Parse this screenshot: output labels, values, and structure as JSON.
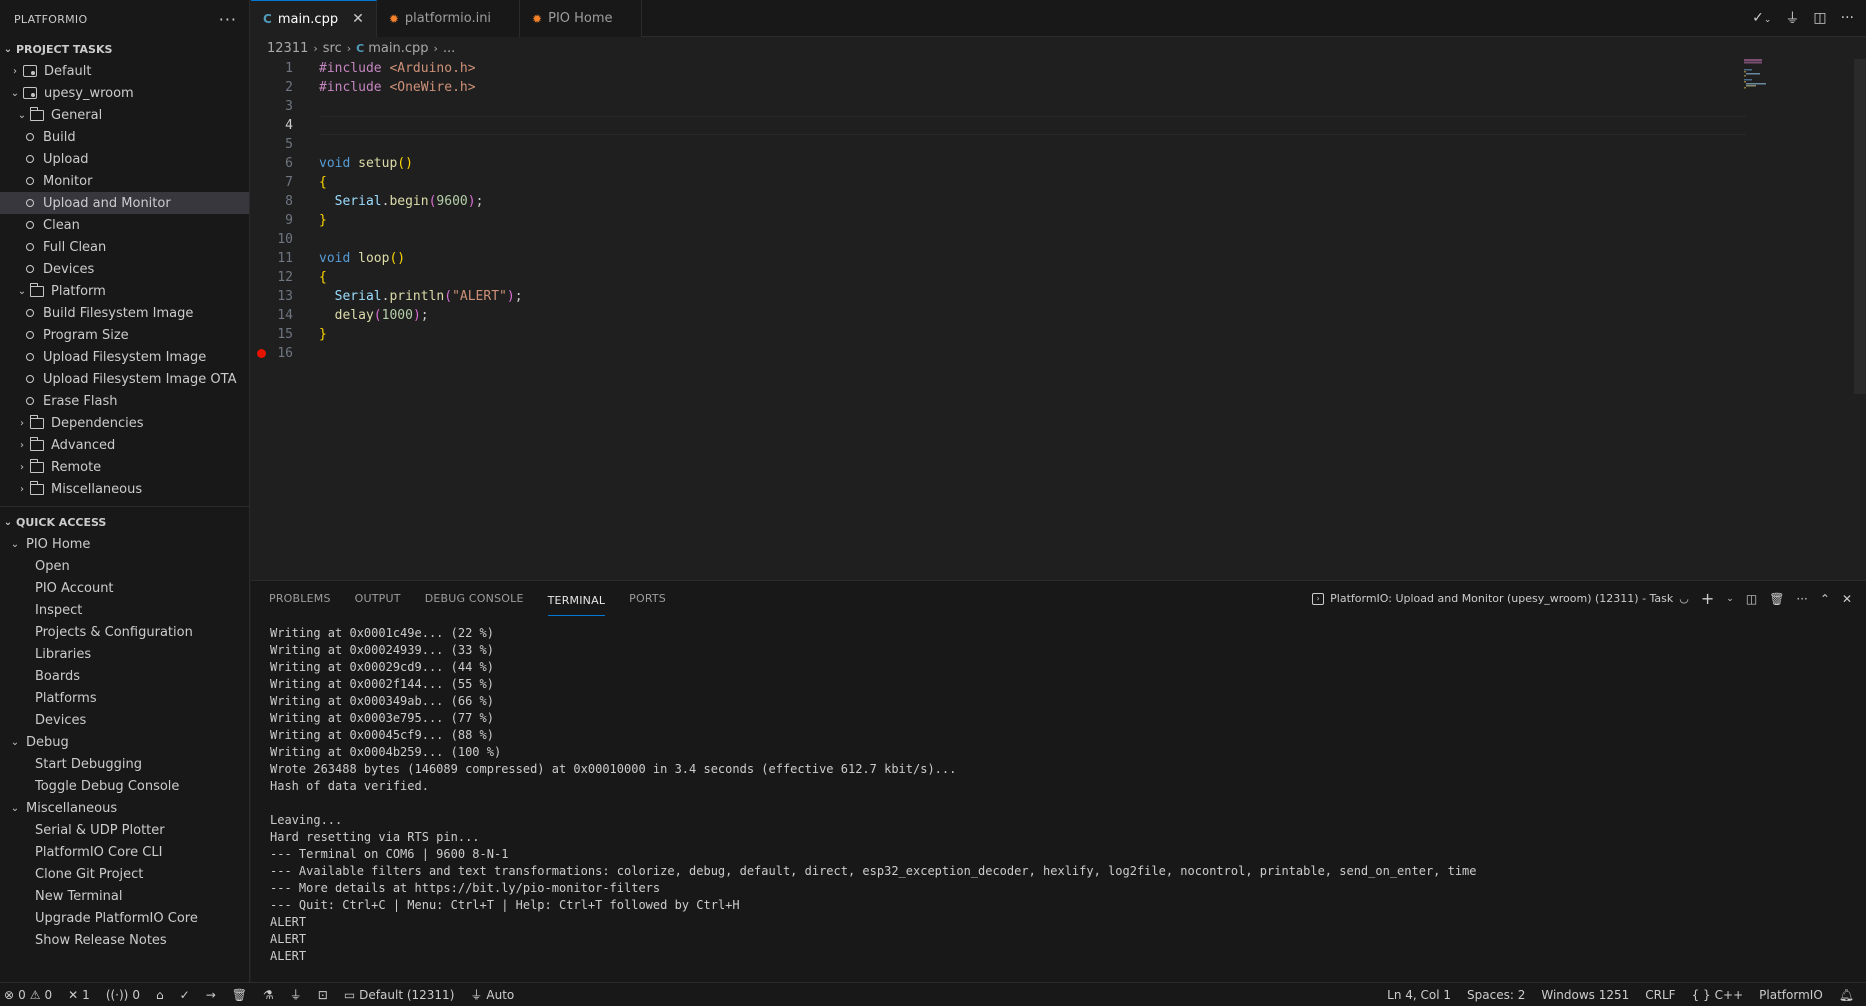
{
  "sidebar": {
    "title": "PLATFORMIO",
    "more": "···",
    "project_tasks_title": "PROJECT TASKS",
    "env_default": "Default",
    "env_upesy": "upesy_wroom",
    "group_general": "General",
    "general_items": [
      "Build",
      "Upload",
      "Monitor",
      "Upload and Monitor",
      "Clean",
      "Full Clean",
      "Devices"
    ],
    "group_platform": "Platform",
    "platform_items": [
      "Build Filesystem Image",
      "Program Size",
      "Upload Filesystem Image",
      "Upload Filesystem Image OTA",
      "Erase Flash"
    ],
    "group_dependencies": "Dependencies",
    "group_advanced": "Advanced",
    "group_remote": "Remote",
    "group_misc": "Miscellaneous",
    "quick_access_title": "QUICK ACCESS",
    "qa_pio_home": "PIO Home",
    "qa_pio_home_items": [
      "Open",
      "PIO Account",
      "Inspect",
      "Projects & Configuration",
      "Libraries",
      "Boards",
      "Platforms",
      "Devices"
    ],
    "qa_debug": "Debug",
    "qa_debug_items": [
      "Start Debugging",
      "Toggle Debug Console"
    ],
    "qa_misc": "Miscellaneous",
    "qa_misc_items": [
      "Serial & UDP Plotter",
      "PlatformIO Core CLI",
      "Clone Git Project",
      "New Terminal",
      "Upgrade PlatformIO Core",
      "Show Release Notes"
    ]
  },
  "tabs": [
    {
      "label": "main.cpp",
      "icon": "C"
    },
    {
      "label": "platformio.ini",
      "icon": "pio-icon"
    },
    {
      "label": "PIO Home",
      "icon": "pio-icon"
    }
  ],
  "breadcrumb": {
    "project": "12311",
    "folder": "src",
    "file": "main.cpp",
    "more": "..."
  },
  "editor": {
    "line_numbers": [
      "1",
      "2",
      "3",
      "4",
      "5",
      "6",
      "7",
      "8",
      "9",
      "10",
      "11",
      "12",
      "13",
      "14",
      "15",
      "16"
    ],
    "current_line": "4",
    "code": {
      "l1_inc": "#include",
      "l1_hdr": "<Arduino.h>",
      "l2_inc": "#include",
      "l2_hdr": "<OneWire.h>",
      "l6_kw": "void",
      "l6_fn": "setup",
      "l8_obj": "Serial",
      "l8_fn": "begin",
      "l8_num": "9600",
      "l11_kw": "void",
      "l11_fn": "loop",
      "l13_obj": "Serial",
      "l13_fn": "println",
      "l13_str": "\"ALERT\"",
      "l14_fn": "delay",
      "l14_num": "1000"
    }
  },
  "panel": {
    "tabs": [
      "PROBLEMS",
      "OUTPUT",
      "DEBUG CONSOLE",
      "TERMINAL",
      "PORTS"
    ],
    "active_tab": "TERMINAL",
    "terminal_title": "PlatformIO: Upload and Monitor (upesy_wroom) (12311) - Task",
    "lines": [
      "Writing at 0x0001c49e... (22 %)",
      "Writing at 0x00024939... (33 %)",
      "Writing at 0x00029cd9... (44 %)",
      "Writing at 0x0002f144... (55 %)",
      "Writing at 0x000349ab... (66 %)",
      "Writing at 0x0003e795... (77 %)",
      "Writing at 0x00045cf9... (88 %)",
      "Writing at 0x0004b259... (100 %)",
      "Wrote 263488 bytes (146089 compressed) at 0x00010000 in 3.4 seconds (effective 612.7 kbit/s)...",
      "Hash of data verified.",
      "",
      "Leaving...",
      "Hard resetting via RTS pin...",
      "--- Terminal on COM6 | 9600 8-N-1",
      "--- Available filters and text transformations: colorize, debug, default, direct, esp32_exception_decoder, hexlify, log2file, nocontrol, printable, send_on_enter, time",
      "--- More details at https://bit.ly/pio-monitor-filters",
      "--- Quit: Ctrl+C | Menu: Ctrl+T | Help: Ctrl+T followed by Ctrl+H",
      "ALERT",
      "ALERT",
      "ALERT"
    ]
  },
  "statusbar": {
    "errors": "0",
    "warnings": "0",
    "ports_count": "1",
    "signals": "0",
    "env": "Default (12311)",
    "port": "Auto",
    "position": "Ln 4, Col 1",
    "spaces": "Spaces: 2",
    "encoding": "Windows 1251",
    "eol": "CRLF",
    "language": "C++",
    "platformio": "PlatformIO"
  },
  "colors": {
    "accent": "#0078d4",
    "breakpoint": "#e51400"
  }
}
